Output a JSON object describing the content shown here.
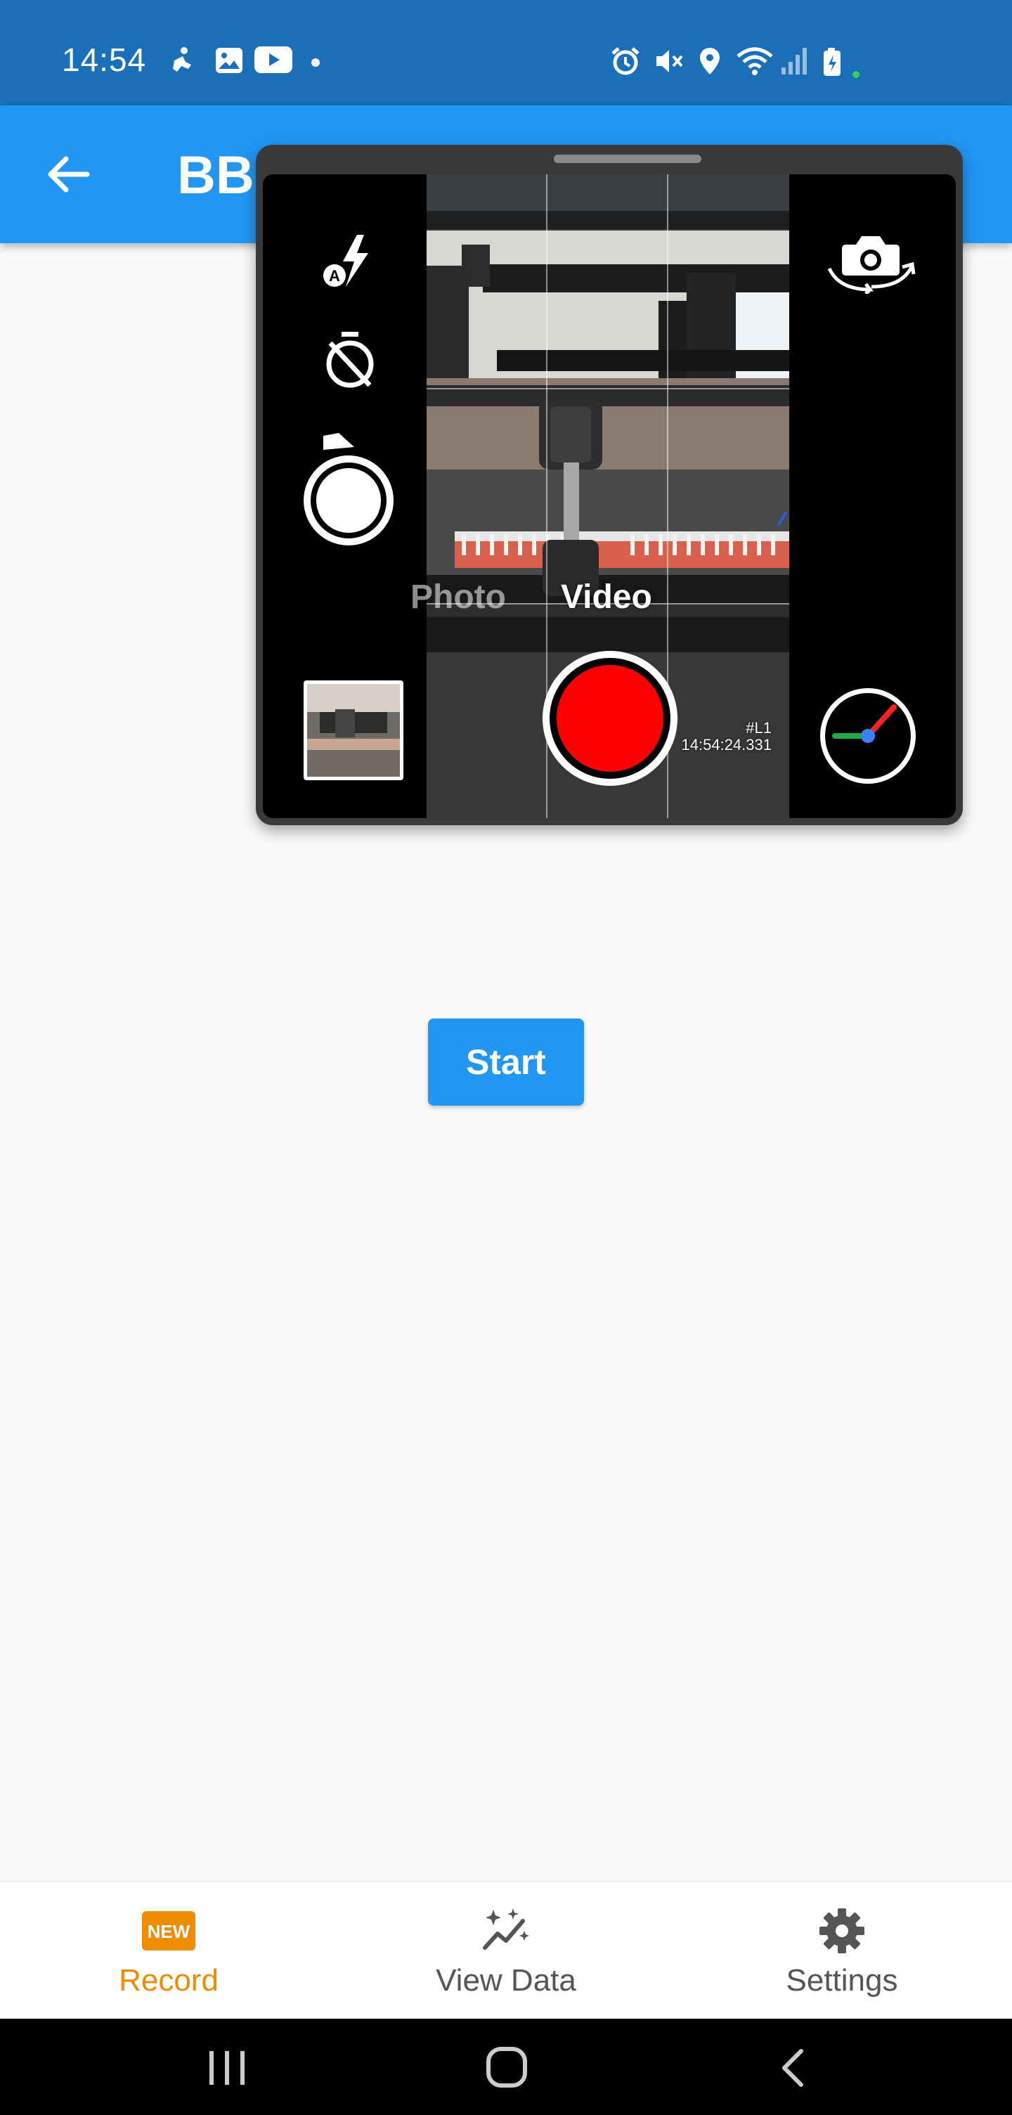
{
  "status_bar": {
    "time": "14:54",
    "icons_left": [
      "accessibility-icon",
      "gallery-icon",
      "youtube-icon",
      "dot-icon"
    ],
    "icons_right": [
      "alarm-icon",
      "mute-icon",
      "location-icon",
      "wifi-icon",
      "signal-icon",
      "battery-icon"
    ]
  },
  "app_bar": {
    "title": "BBC",
    "back_icon": "arrow-back-icon"
  },
  "camera_overlay": {
    "left_controls": [
      "flash-auto-icon",
      "timer-off-icon",
      "shutter-photo-icon"
    ],
    "right_controls": [
      "switch-camera-icon",
      "speedometer-icon"
    ],
    "modes": {
      "photo": "Photo",
      "video": "Video",
      "selected": "Video"
    },
    "timestamp_tag": "#L1",
    "timestamp": "14:54:24.331",
    "record_color": "#ff0000"
  },
  "main": {
    "start_label": "Start"
  },
  "bottom_nav": {
    "items": [
      {
        "label": "Record",
        "icon": "new-badge-icon",
        "badge": "NEW",
        "active": true
      },
      {
        "label": "View Data",
        "icon": "sparkle-chart-icon",
        "active": false
      },
      {
        "label": "Settings",
        "icon": "gear-icon",
        "active": false
      }
    ],
    "active_color": "#f08c00",
    "inactive_color": "#555555"
  },
  "system_nav": [
    "recents-icon",
    "home-icon",
    "back-icon"
  ]
}
